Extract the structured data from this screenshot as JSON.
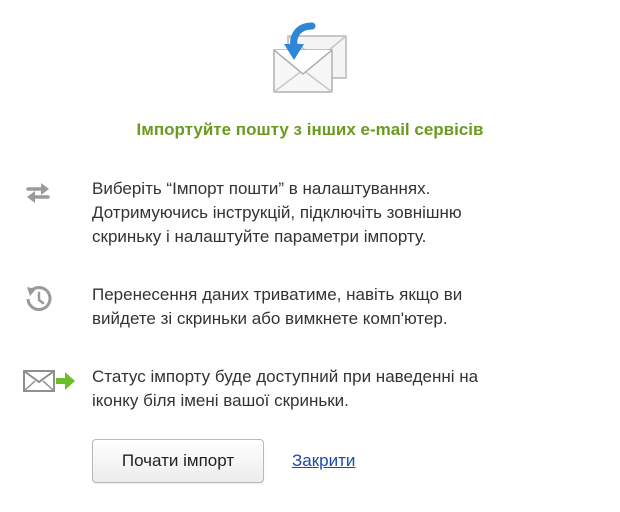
{
  "header": {
    "icon": "mail-import-icon",
    "title": "Імпортуйте пошту з інших e-mail сервісів"
  },
  "steps": [
    {
      "icon": "sync-arrows-icon",
      "lines": [
        "Виберіть “Імпорт пошти” в налаштуваннях.",
        "Дотримуючись інструкцій, підключіть зовнішню",
        "скриньку і налаштуйте параметри імпорту."
      ]
    },
    {
      "icon": "clock-history-icon",
      "lines": [
        "Перенесення даних триватиме, навіть якщо ви",
        "вийдете зі скриньки або вимкнете комп'ютер."
      ]
    },
    {
      "icon": "mail-arrow-icon",
      "lines": [
        "Статус імпорту буде доступний при наведенні на",
        "іконку біля імені вашої скриньки."
      ]
    }
  ],
  "actions": {
    "start_label": "Почати імпорт",
    "close_label": "Закрити"
  },
  "colors": {
    "title": "#6a9a1f",
    "icon_gray": "#9a9a9a",
    "arrow_blue": "#2f86d6",
    "arrow_green": "#6bbd2a",
    "link": "#1b4aa8"
  }
}
